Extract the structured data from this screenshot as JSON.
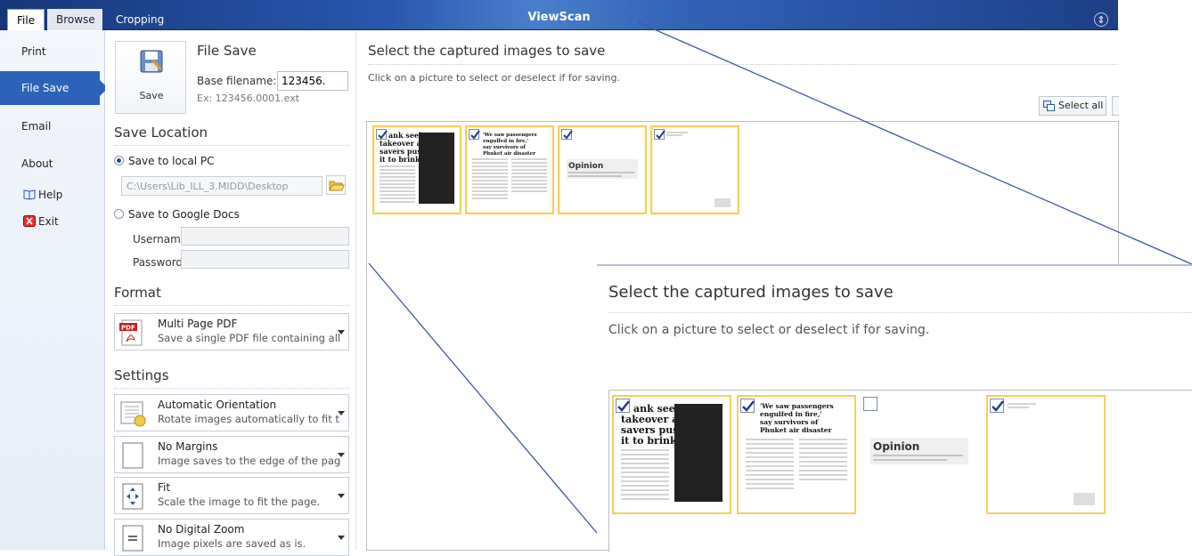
{
  "ribbon": {
    "tabs": [
      "File",
      "Browse",
      "Cropping"
    ],
    "title": "ViewScan"
  },
  "nav": {
    "print": "Print",
    "file_save": "File Save",
    "email": "Email",
    "about": "About",
    "help": "Help",
    "exit": "Exit"
  },
  "file_save": {
    "save_label": "Save",
    "title": "File Save",
    "base_filename_label": "Base filename:",
    "base_filename_value": "123456.",
    "example": "Ex: 123456.0001.ext"
  },
  "save_location": {
    "title": "Save Location",
    "local_label": "Save to local PC",
    "local_selected": true,
    "path": "C:\\Users\\Lib_ILL_3.MIDD\\Desktop",
    "google_label": "Save to Google Docs",
    "username_label": "Username",
    "password_label": "Password"
  },
  "format": {
    "title": "Format",
    "selected_title": "Multi Page PDF",
    "selected_sub": "Save a single PDF file containing all c"
  },
  "settings": {
    "title": "Settings",
    "orientation": {
      "title": "Automatic Orientation",
      "sub": "Rotate images automatically to fit th"
    },
    "margins": {
      "title": "No Margins",
      "sub": "Image saves to the edge of the page"
    },
    "fit": {
      "title": "Fit",
      "sub": "Scale the image to fit the page."
    },
    "zoom": {
      "title": "No Digital Zoom",
      "sub": "Image pixels are saved as is."
    }
  },
  "main": {
    "title": "Select the captured images to save",
    "subtitle": "Click on a picture to select or deselect if for saving.",
    "select_all": "Select all",
    "thumbnails": [
      {
        "checked": true,
        "headline": "ank seeks takeover as savers push it to brink"
      },
      {
        "checked": true,
        "headline": "'We saw passengers engulfed in fire,' say survivors of Phuket air disaster"
      },
      {
        "checked": true,
        "headline": "Opinion"
      },
      {
        "checked": true,
        "headline": ""
      }
    ]
  },
  "zoom": {
    "title": "Select the captured images to save",
    "subtitle": "Click on a picture to select or deselect if for saving.",
    "thumbnails": [
      {
        "checked": true,
        "headline": "ank seeks takeover as savers push it to brink"
      },
      {
        "checked": true,
        "headline": "'We saw passengers engulfed in fire,' say survivors of Phuket air disaster"
      },
      {
        "checked": false,
        "headline": "Opinion"
      },
      {
        "checked": true,
        "headline": ""
      }
    ]
  },
  "colors": {
    "ribbon_dark": "#15377a",
    "nav_selected": "#2d63b8",
    "thumb_selected_border": "#f3d05c",
    "pointer_line": "#3b5aa3"
  }
}
